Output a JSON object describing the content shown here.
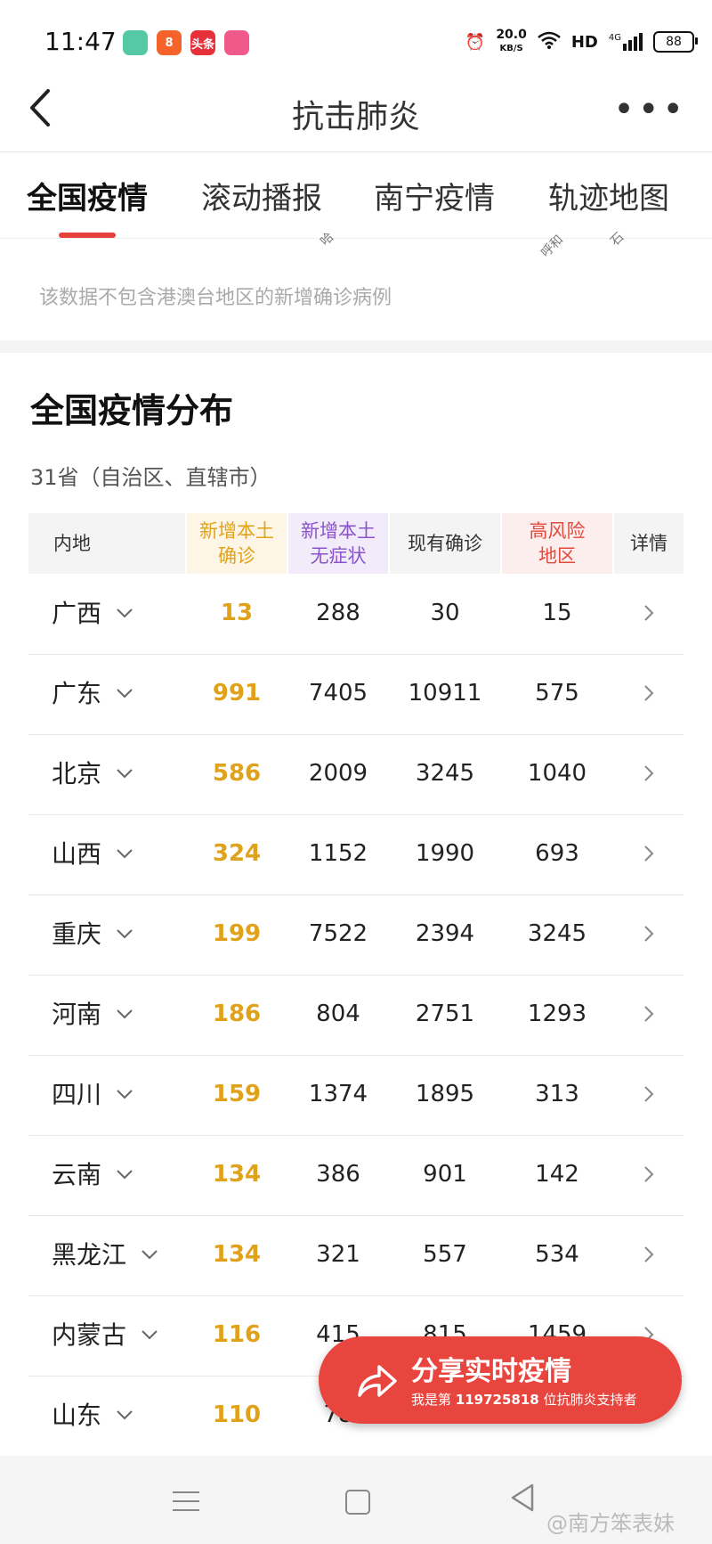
{
  "status": {
    "time": "11:47",
    "net_speed": "20.0",
    "net_unit": "KB/S",
    "hd": "HD",
    "network": "4G",
    "battery": "88",
    "app_icons": [
      {
        "name": "app-green",
        "color": "#55c9a6",
        "label": ""
      },
      {
        "name": "app-orange",
        "color": "#f5632b",
        "label": "8"
      },
      {
        "name": "app-toutiao",
        "color": "#e8303a",
        "label": "头条"
      },
      {
        "name": "app-pink",
        "color": "#f05a8b",
        "label": ""
      }
    ]
  },
  "header": {
    "title": "抗击肺炎",
    "more": "•••"
  },
  "tabs": [
    {
      "label": "全国疫情",
      "active": true
    },
    {
      "label": "滚动播报",
      "active": false
    },
    {
      "label": "南宁疫情",
      "active": false
    },
    {
      "label": "轨迹地图",
      "active": false
    }
  ],
  "cutoff_labels": [
    "哈",
    "呼和",
    "石"
  ],
  "note": "该数据不包含港澳台地区的新增确诊病例",
  "section": {
    "title": "全国疫情分布",
    "subtitle": "31省（自治区、直辖市）"
  },
  "table": {
    "headers": {
      "region": "内地",
      "new_local_line1": "新增本土",
      "new_local_line2": "确诊",
      "new_asym_line1": "新增本土",
      "new_asym_line2": "无症状",
      "current": "现有确诊",
      "risk_line1": "高风险",
      "risk_line2": "地区",
      "detail": "详情"
    },
    "rows": [
      {
        "name": "广西",
        "new": "13",
        "asym": "288",
        "current": "30",
        "risk": "15"
      },
      {
        "name": "广东",
        "new": "991",
        "asym": "7405",
        "current": "10911",
        "risk": "575"
      },
      {
        "name": "北京",
        "new": "586",
        "asym": "2009",
        "current": "3245",
        "risk": "1040"
      },
      {
        "name": "山西",
        "new": "324",
        "asym": "1152",
        "current": "1990",
        "risk": "693"
      },
      {
        "name": "重庆",
        "new": "199",
        "asym": "7522",
        "current": "2394",
        "risk": "3245"
      },
      {
        "name": "河南",
        "new": "186",
        "asym": "804",
        "current": "2751",
        "risk": "1293"
      },
      {
        "name": "四川",
        "new": "159",
        "asym": "1374",
        "current": "1895",
        "risk": "313"
      },
      {
        "name": "云南",
        "new": "134",
        "asym": "386",
        "current": "901",
        "risk": "142"
      },
      {
        "name": "黑龙江",
        "new": "134",
        "asym": "321",
        "current": "557",
        "risk": "534"
      },
      {
        "name": "内蒙古",
        "new": "116",
        "asym": "415",
        "current": "815",
        "risk": "1459"
      },
      {
        "name": "山东",
        "new": "110",
        "asym": "78",
        "current": "",
        "risk": ""
      }
    ]
  },
  "share": {
    "title": "分享实时疫情",
    "sub_prefix": "我是第",
    "sub_number": "119725818",
    "sub_suffix": "位抗肺炎支持者"
  },
  "watermark": "@南方笨表妹",
  "colors": {
    "accent": "#e8403b",
    "new_confirmed": "#e0a21a",
    "asymptomatic": "#8a54c8",
    "high_risk": "#e14a3c"
  }
}
